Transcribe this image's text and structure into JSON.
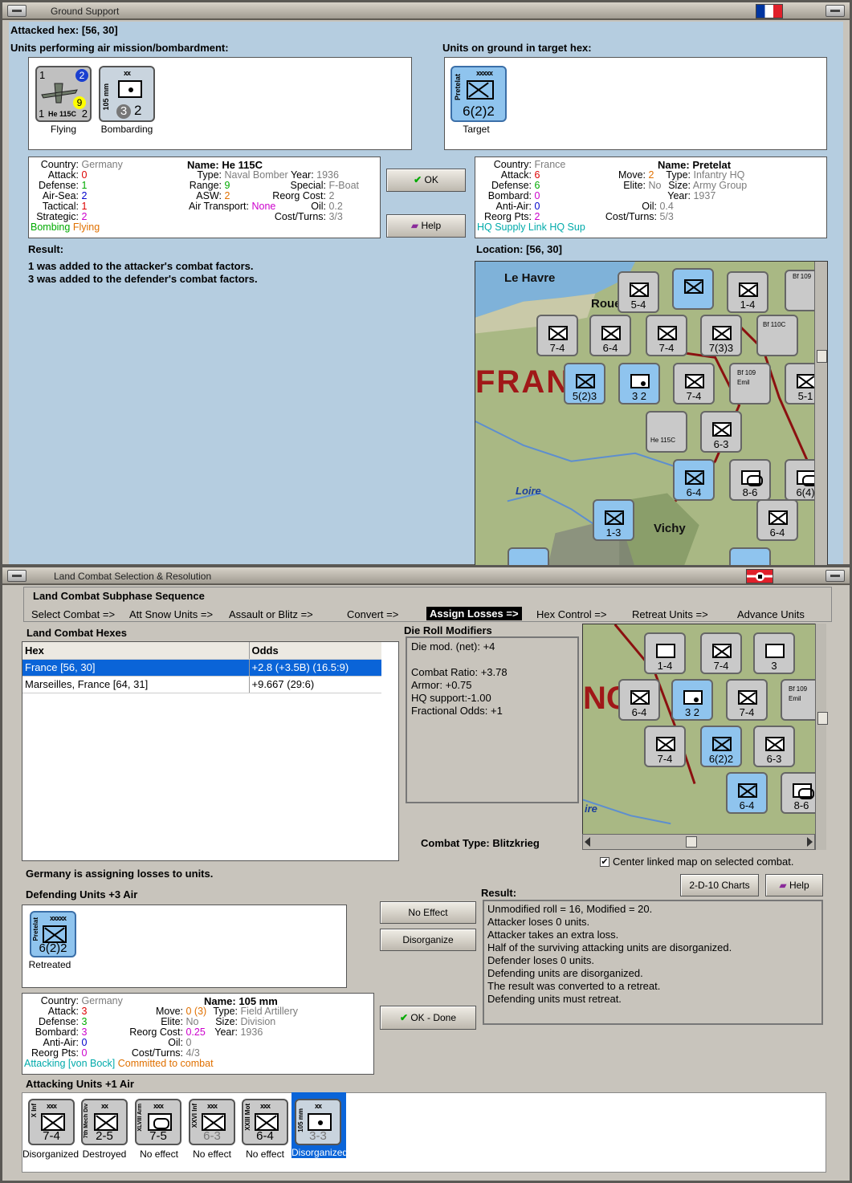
{
  "win1": {
    "title": "Ground Support"
  },
  "gs": {
    "attacked_hex": "Attacked hex:  [56, 30]",
    "air_units_heading": "Units performing air mission/bombardment:",
    "ground_units_heading": "Units on ground in target hex:",
    "air_units": [
      {
        "label": "Flying",
        "name": "He 115C",
        "tl": "1",
        "tr": "2",
        "br": "2",
        "mid": "9",
        "bl": "1"
      },
      {
        "label": "Bombarding",
        "size": "xx",
        "side": "105 mm",
        "atk": "3",
        "def": "2"
      }
    ],
    "ground_unit": {
      "label": "Target",
      "size": "xxxxx",
      "side": "Pretelat",
      "str": "6(2)2"
    },
    "attacker": {
      "country_lbl": "Country:",
      "country": "Germany",
      "attack_lbl": "Attack:",
      "attack": "0",
      "defense_lbl": "Defense:",
      "defense": "1",
      "airsea_lbl": "Air-Sea:",
      "airsea": "2",
      "tactical_lbl": "Tactical:",
      "tactical": "1",
      "strategic_lbl": "Strategic:",
      "strategic": "2",
      "name_lbl": "Name:",
      "name": "He 115C",
      "type_lbl": "Type:",
      "type": "Naval Bomber",
      "year_lbl": "Year:",
      "year": "1936",
      "range_lbl": "Range:",
      "range": "9",
      "special_lbl": "Special:",
      "special": "F-Boat",
      "asw_lbl": "ASW:",
      "asw": "2",
      "reorg_lbl": "Reorg Cost:",
      "reorg": "2",
      "oil_lbl": "Oil:",
      "oil": "0.2",
      "airtrans_lbl": "Air Transport:",
      "airtrans": "None",
      "cost_lbl": "Cost/Turns:",
      "cost": "3/3",
      "status1": "Bombing",
      "status2": "Flying"
    },
    "defender": {
      "country_lbl": "Country:",
      "country": "France",
      "attack_lbl": "Attack:",
      "attack": "6",
      "defense_lbl": "Defense:",
      "defense": "6",
      "bombard_lbl": "Bombard:",
      "bombard": "0",
      "antiair_lbl": "Anti-Air:",
      "antiair": "0",
      "reorgpts_lbl": "Reorg Pts:",
      "reorgpts": "2",
      "name_lbl": "Name:",
      "name": "Pretelat",
      "move_lbl": "Move:",
      "move": "2",
      "type_lbl": "Type:",
      "type": "Infantry HQ",
      "elite_lbl": "Elite:",
      "elite": "No",
      "size_lbl": "Size:",
      "size": "Army Group",
      "year_lbl": "Year:",
      "year": "1937",
      "oil_lbl": "Oil:",
      "oil": "0.4",
      "cost_lbl": "Cost/Turns:",
      "cost": "5/3",
      "status": "HQ Supply Link HQ Sup"
    },
    "ok_label": "OK",
    "help_label": "Help",
    "result_heading": "Result:",
    "result_lines": [
      "1 was added to the attacker's combat factors.",
      "3 was added to the defender's combat factors."
    ],
    "location": "Location:  [56, 30]"
  },
  "map1": {
    "places": [
      "Le Havre",
      "Roue",
      "FRANC",
      "Loire",
      "Vichy"
    ],
    "counters": [
      "5-4",
      "1-4",
      "7-4",
      "6-4",
      "7-4",
      "7(3)3",
      "5(2)3",
      "3 2",
      "7-4",
      "5-1",
      "6-3",
      "6-4",
      "8-6",
      "6(4)",
      "1-3",
      "6-4",
      "Emil",
      "Emil",
      "Bf 109",
      "Bf 110C",
      "Bf 109",
      "He 115C"
    ]
  },
  "win2": {
    "title": "Land Combat Selection & Resolution"
  },
  "lc": {
    "seq_heading": "Land Combat Subphase Sequence",
    "sequence": [
      "Select Combat =>",
      "Att Snow Units =>",
      "Assault or Blitz =>",
      "Convert =>",
      "Assign Losses =>",
      "Hex Control =>",
      "Retreat Units =>",
      "Advance Units"
    ],
    "hexes_heading": "Land Combat Hexes",
    "col_hex": "Hex",
    "col_odds": "Odds",
    "rows": [
      {
        "hex": "France [56, 30]",
        "odds": "+2.8 (+3.5B) (16.5:9)"
      },
      {
        "hex": "Marseilles, France [64, 31]",
        "odds": "+9.667 (29:6)"
      }
    ],
    "drm_heading": "Die Roll Modifiers",
    "drm": [
      "Die mod. (net): +4",
      "",
      "Combat Ratio: +3.78",
      "Armor: +0.75",
      "HQ support:-1.00",
      "Fractional Odds: +1"
    ],
    "combat_type_lbl": "Combat Type:",
    "combat_type": "Blitzkrieg",
    "center_map": "Center linked map on selected combat.",
    "charts_label": "2-D-10 Charts",
    "help_label": "Help",
    "assigning": "Germany is assigning losses to units.",
    "defending_heading": "Defending Units +3 Air",
    "defending_unit": {
      "size": "xxxxx",
      "side": "Pretelat",
      "str": "6(2)2",
      "label": "Retreated"
    },
    "no_effect": "No Effect",
    "disorganize": "Disorganize",
    "ok_done": "OK - Done",
    "result_heading": "Result:",
    "result_lines": [
      "Unmodified roll = 16, Modified = 20.",
      "Attacker loses 0 units.",
      "Attacker takes an extra loss.",
      "Half of the surviving attacking units are disorganized.",
      "Defender loses 0 units.",
      "Defending units are disorganized.",
      "The result was converted to a retreat.",
      "Defending units must retreat."
    ],
    "unit": {
      "country_lbl": "Country:",
      "country": "Germany",
      "attack_lbl": "Attack:",
      "attack": "3",
      "defense_lbl": "Defense:",
      "defense": "3",
      "bombard_lbl": "Bombard:",
      "bombard": "3",
      "antiair_lbl": "Anti-Air:",
      "antiair": "0",
      "reorgpts_lbl": "Reorg Pts:",
      "reorgpts": "0",
      "name_lbl": "Name:",
      "name": "105 mm",
      "move_lbl": "Move:",
      "move": "0",
      "move2": "(3)",
      "type_lbl": "Type:",
      "type": "Field Artillery",
      "elite_lbl": "Elite:",
      "elite": "No",
      "size_lbl": "Size:",
      "size": "Division",
      "reorg_lbl": "Reorg Cost:",
      "reorg": "0.25",
      "year_lbl": "Year:",
      "year": "1936",
      "oil_lbl": "Oil:",
      "oil": "0",
      "cost_lbl": "Cost/Turns:",
      "cost": "4/3",
      "status1": "Attacking [von Bock]",
      "status2": "Committed to combat"
    },
    "attacking_heading": "Attacking Units +1 Air",
    "attacking_units": [
      {
        "size": "xxx",
        "side": "X Inf",
        "str": "7-4",
        "label": "Disorganized",
        "sym": "x"
      },
      {
        "size": "xx",
        "side": "7th Mech Div",
        "str": "2-5",
        "label": "Destroyed",
        "sym": "x"
      },
      {
        "size": "xxx",
        "side": "XLVIII Arm",
        "str": "7-5",
        "label": "No effect",
        "sym": "arm"
      },
      {
        "size": "xxx",
        "side": "XXVI Inf",
        "str": "6-3",
        "label": "No effect",
        "sym": "x"
      },
      {
        "size": "xxx",
        "side": "XXIII Mot",
        "str": "6-4",
        "label": "No effect",
        "sym": "x"
      },
      {
        "size": "xx",
        "side": "105 mm",
        "str": "3-3",
        "label": "Disorganized",
        "sym": "dot"
      }
    ]
  },
  "map2": {
    "places": [
      "NC",
      "ire"
    ],
    "counters": [
      "1-4",
      "7-4",
      "3",
      "6-4",
      "3 2",
      "7-4",
      "7-4",
      "6(2)2",
      "6-3",
      "6-4",
      "8-6",
      "Emil",
      "Bf 109"
    ]
  }
}
